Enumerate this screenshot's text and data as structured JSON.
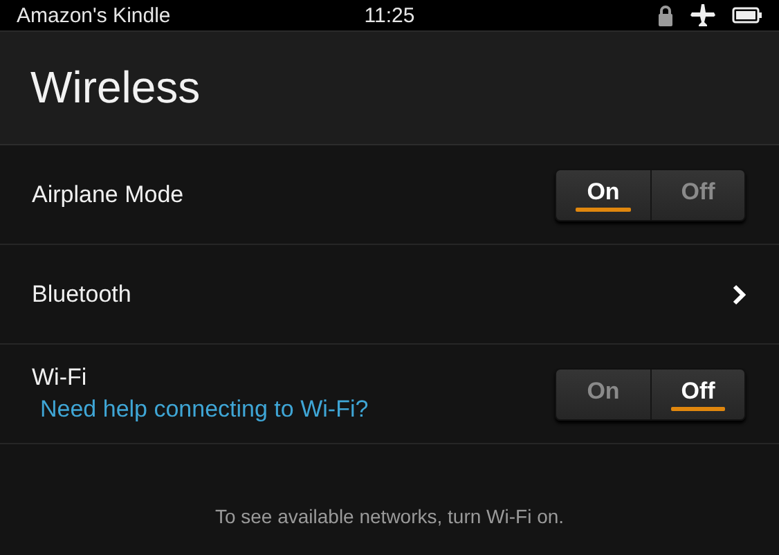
{
  "status_bar": {
    "device_name": "Amazon's Kindle",
    "time": "11:25"
  },
  "title": "Wireless",
  "settings": [
    {
      "kind": "toggle",
      "label": "Airplane Mode",
      "options": [
        {
          "label": "On",
          "selected": true
        },
        {
          "label": "Off",
          "selected": false
        }
      ]
    },
    {
      "kind": "nav",
      "label": "Bluetooth"
    },
    {
      "kind": "toggle",
      "label": "Wi-Fi",
      "link": "Need help connecting to Wi-Fi?",
      "options": [
        {
          "label": "On",
          "selected": false
        },
        {
          "label": "Off",
          "selected": true
        }
      ]
    }
  ],
  "footer_note": "To see available networks, turn Wi-Fi on."
}
